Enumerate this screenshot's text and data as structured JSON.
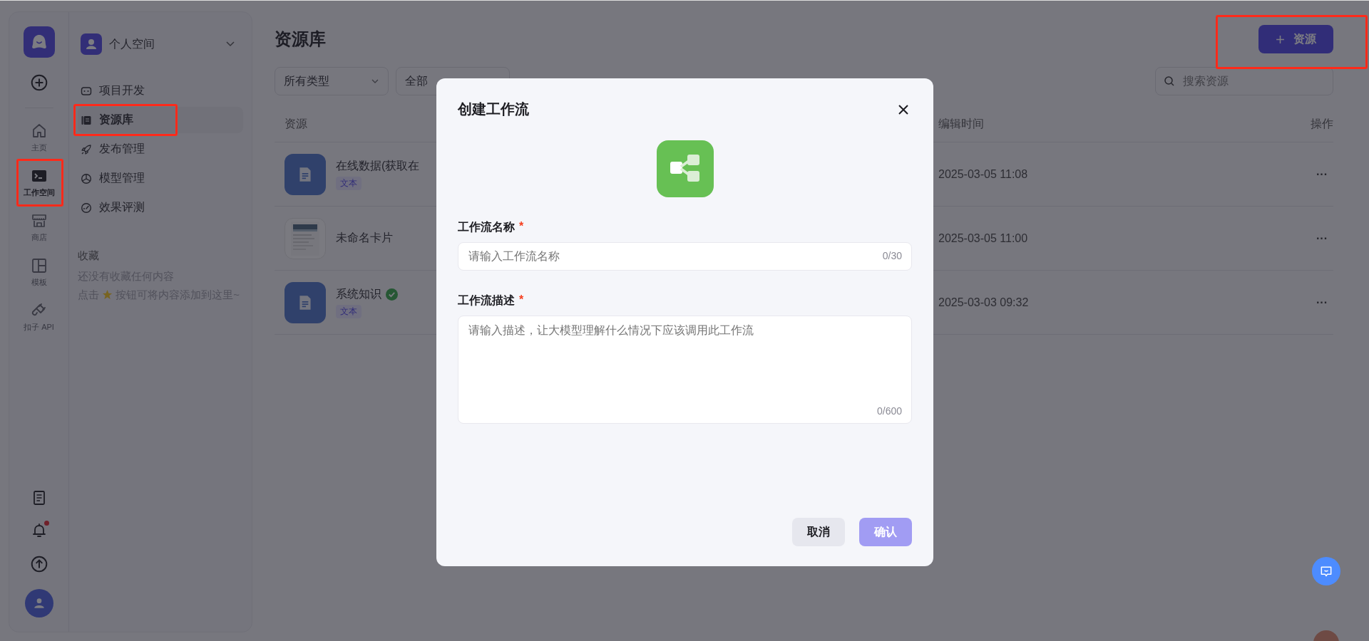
{
  "rail": {
    "items": [
      {
        "label": "主页",
        "selected": false,
        "highlighted": false
      },
      {
        "label": "工作空间",
        "selected": true,
        "highlighted": true
      },
      {
        "label": "商店",
        "selected": false,
        "highlighted": false
      },
      {
        "label": "模板",
        "selected": false,
        "highlighted": false
      },
      {
        "label": "扣子 API",
        "selected": false,
        "highlighted": false
      }
    ],
    "unread_notifications": true
  },
  "space": {
    "name": "个人空间"
  },
  "menu": [
    {
      "label": "项目开发",
      "selected": false,
      "highlighted": false
    },
    {
      "label": "资源库",
      "selected": true,
      "highlighted": true
    },
    {
      "label": "发布管理",
      "selected": false,
      "highlighted": false
    },
    {
      "label": "模型管理",
      "selected": false,
      "highlighted": false
    },
    {
      "label": "效果评测",
      "selected": false,
      "highlighted": false
    }
  ],
  "favorites": {
    "title": "收藏",
    "empty_text": "还没有收藏任何内容",
    "hint_before": "点击",
    "hint_after": "按钮可将内容添加到这里~"
  },
  "page": {
    "title": "资源库",
    "add_button": {
      "label": "资源",
      "highlighted": true
    },
    "filters": [
      {
        "value": "所有类型"
      },
      {
        "value": "全部"
      }
    ],
    "search": {
      "placeholder": "搜索资源"
    }
  },
  "table": {
    "columns": [
      "资源",
      "编辑时间",
      "操作"
    ],
    "rows": [
      {
        "name": "在线数据(获取在",
        "kind": "document",
        "tag": "文本",
        "verified": false,
        "edited": "2025-03-05 11:08",
        "action": "···"
      },
      {
        "name": "未命名卡片",
        "kind": "card",
        "verified": false,
        "edited": "2025-03-05 11:00",
        "action": "···"
      },
      {
        "name": "系统知识",
        "kind": "document",
        "tag": "文本",
        "verified": true,
        "edited": "2025-03-03 09:32",
        "action": "···"
      }
    ]
  },
  "dialog": {
    "title": "创建工作流",
    "fields": [
      {
        "kind": "input",
        "label": "工作流名称",
        "required_mark": "*",
        "placeholder": "请输入工作流名称",
        "counter": "0/30"
      },
      {
        "kind": "textarea",
        "label": "工作流描述",
        "required_mark": "*",
        "placeholder": "请输入描述，让大模型理解什么情况下应该调用此工作流",
        "counter": "0/600"
      }
    ],
    "buttons": [
      {
        "label": "取消",
        "kind": "secondary",
        "disabled": false
      },
      {
        "label": "确认",
        "kind": "primary",
        "disabled": true
      }
    ]
  }
}
